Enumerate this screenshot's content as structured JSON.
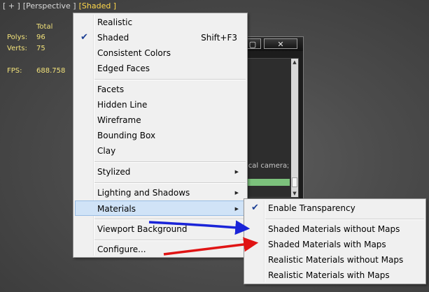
{
  "viewport_label": {
    "plus": "[ + ]",
    "view": "[Perspective ]",
    "mode": "[Shaded ]"
  },
  "stats": {
    "header": "Total",
    "polys_label": "Polys:",
    "polys": "96",
    "verts_label": "Verts:",
    "verts": "75",
    "fps_label": "FPS:",
    "fps": "688.758"
  },
  "dialog": {
    "max_glyph": "▢",
    "close_glyph": "✕",
    "body_text": "ical camera;"
  },
  "menu": {
    "realistic": "Realistic",
    "shaded": "Shaded",
    "shaded_shortcut": "Shift+F3",
    "consistent_colors": "Consistent Colors",
    "edged_faces": "Edged Faces",
    "facets": "Facets",
    "hidden_line": "Hidden Line",
    "wireframe": "Wireframe",
    "bounding_box": "Bounding Box",
    "clay": "Clay",
    "stylized": "Stylized",
    "lighting_shadows": "Lighting and Shadows",
    "materials": "Materials",
    "viewport_background": "Viewport Background",
    "configure": "Configure..."
  },
  "submenu": {
    "enable_transparency": "Enable Transparency",
    "shaded_without_maps": "Shaded Materials without Maps",
    "shaded_with_maps": "Shaded Materials with Maps",
    "realistic_without_maps": "Realistic Materials without Maps",
    "realistic_with_maps": "Realistic Materials with Maps"
  },
  "glyphs": {
    "check": "✔",
    "submenu_arrow": "▶"
  },
  "colors": {
    "blue_arrow": "#1a24d8",
    "red_arrow": "#e01414",
    "highlight": "#d0e3f7",
    "stats_text": "#f2e27a"
  }
}
